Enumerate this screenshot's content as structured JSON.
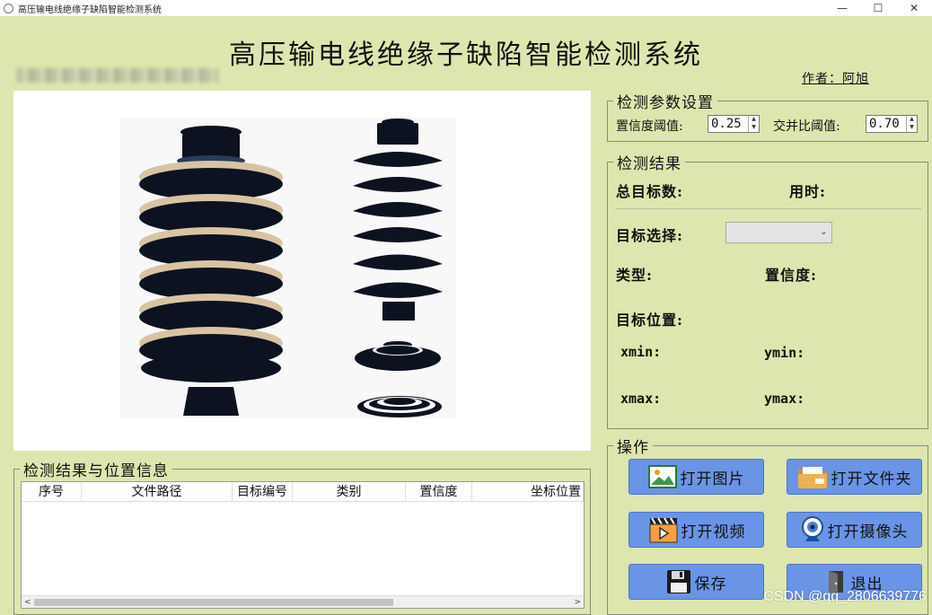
{
  "window": {
    "title": "高压输电线绝缘子缺陷智能检测系统",
    "controls": [
      "—",
      "☐",
      "✕"
    ]
  },
  "header": {
    "title": "高压输电线绝缘子缺陷智能检测系统",
    "author": "作者：阿旭"
  },
  "params": {
    "legend": "检测参数设置",
    "conf_label": "置信度阈值:",
    "conf_value": "0.25",
    "iou_label": "交并比阈值:",
    "iou_value": "0.70"
  },
  "results": {
    "legend": "检测结果",
    "total_label": "总目标数:",
    "time_label": "用时:",
    "target_select_label": "目标选择:",
    "target_select_value": "",
    "type_label": "类型:",
    "confidence_label": "置信度:",
    "position_label": "目标位置:",
    "xmin_label": "xmin:",
    "ymin_label": "ymin:",
    "xmax_label": "xmax:",
    "ymax_label": "ymax:"
  },
  "table": {
    "legend": "检测结果与位置信息",
    "columns": [
      "序号",
      "文件路径",
      "目标编号",
      "类别",
      "置信度",
      "坐标位置"
    ],
    "rows": []
  },
  "operations": {
    "legend": "操作",
    "open_image": "打开图片",
    "open_folder": "打开文件夹",
    "open_video": "打开视频",
    "open_camera": "打开摄像头",
    "save": "保存",
    "exit": "退出"
  },
  "watermark": "CSDN @qq_2806639776",
  "colors": {
    "background": "#dde6ae",
    "button": "#6a94e6",
    "insulator_dark": "#0d1220",
    "insulator_ring": "#d8c4a4"
  }
}
